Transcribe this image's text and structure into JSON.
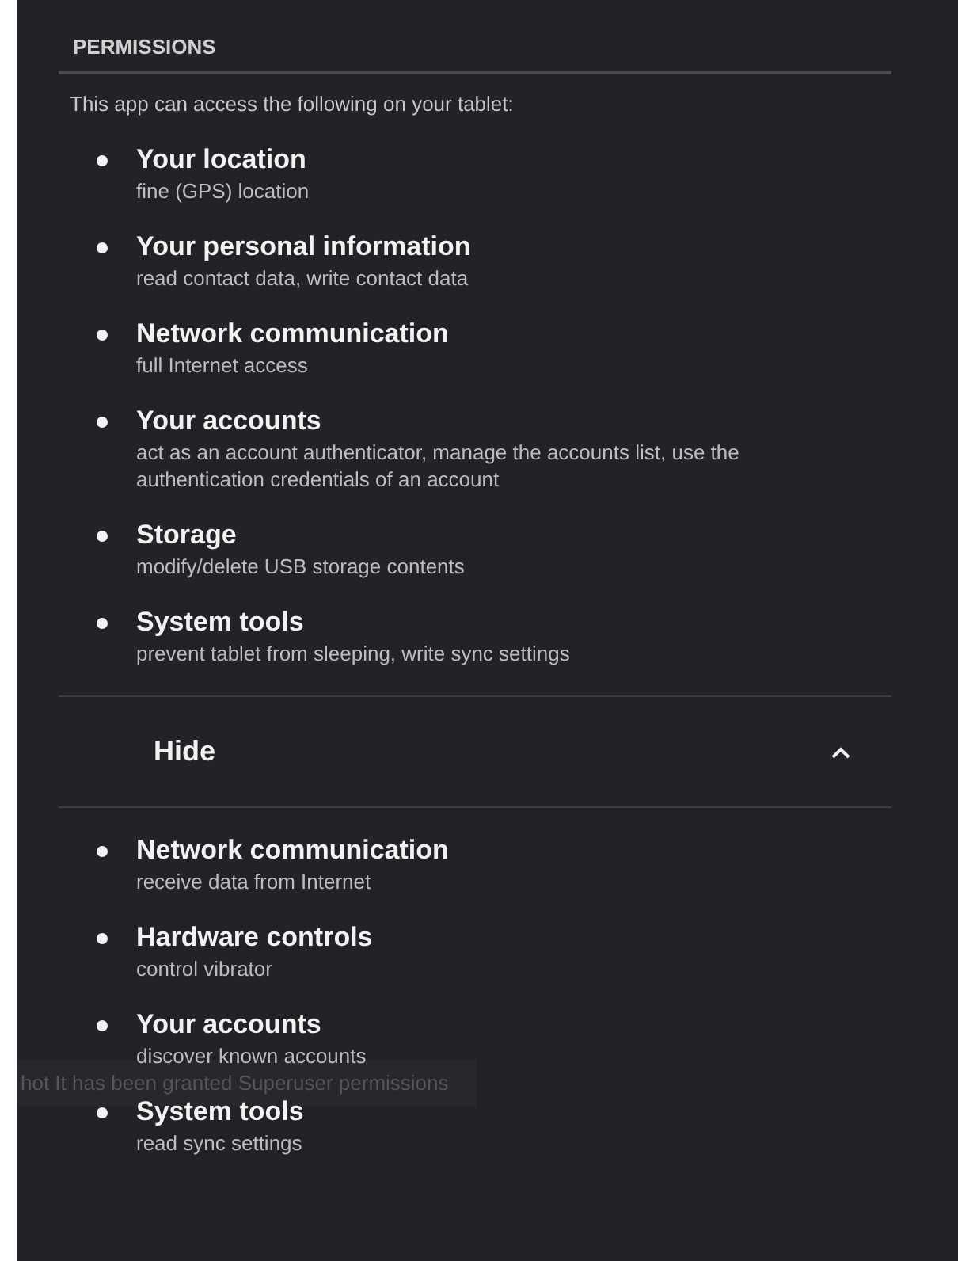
{
  "section_title": "PERMISSIONS",
  "intro": "This app can access the following on your tablet:",
  "permissions": [
    {
      "title": "Your location",
      "description": "fine (GPS) location"
    },
    {
      "title": "Your personal information",
      "description": "read contact data, write contact data"
    },
    {
      "title": "Network communication",
      "description": "full Internet access"
    },
    {
      "title": "Your accounts",
      "description": "act as an account authenticator, manage the accounts list, use the authentication credentials of an account"
    },
    {
      "title": "Storage",
      "description": "modify/delete USB storage contents"
    },
    {
      "title": "System tools",
      "description": "prevent tablet from sleeping, write sync settings"
    }
  ],
  "toggle": {
    "label": "Hide",
    "expanded": true
  },
  "more_permissions": [
    {
      "title": "Network communication",
      "description": "receive data from Internet"
    },
    {
      "title": "Hardware controls",
      "description": "control vibrator"
    },
    {
      "title": "Your accounts",
      "description": "discover known accounts"
    },
    {
      "title": "System tools",
      "description": "read sync settings"
    }
  ],
  "toast": "hot It has been granted Superuser permissions"
}
